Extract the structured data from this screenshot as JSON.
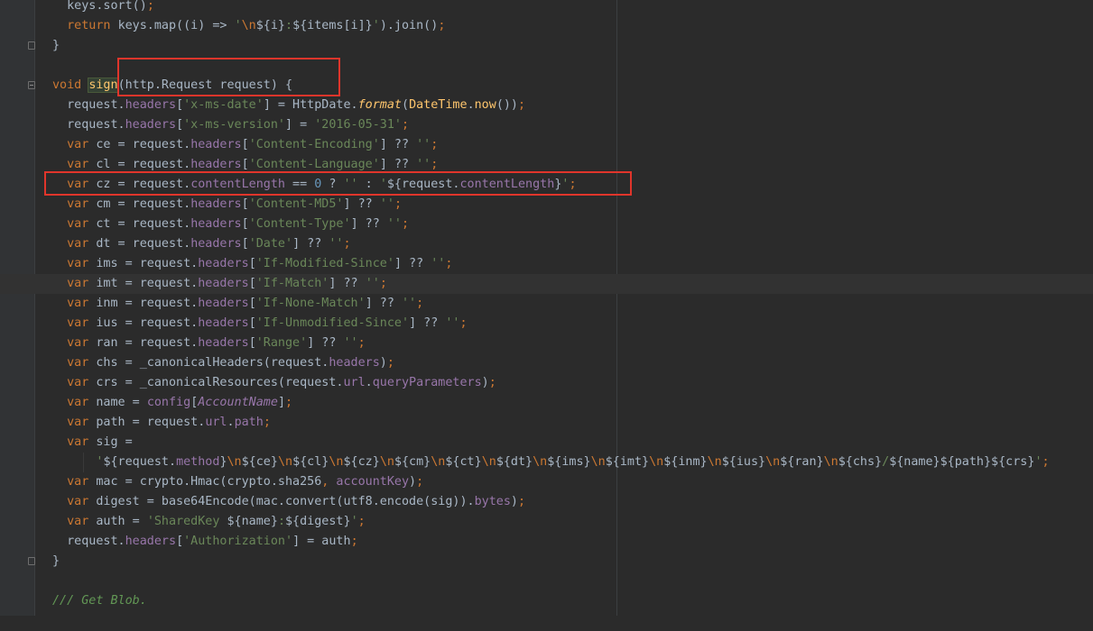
{
  "code_lines": [
    {
      "indent": "  ",
      "tokens": [
        [
          "t",
          "keys.sort()"
        ],
        [
          "k",
          ";"
        ]
      ]
    },
    {
      "indent": "  ",
      "tokens": [
        [
          "k",
          "return "
        ],
        [
          "t",
          "keys.map((i) => "
        ],
        [
          "s",
          "'"
        ],
        [
          "e",
          "\\n"
        ],
        [
          "t",
          "${i}"
        ],
        [
          "s",
          ":"
        ],
        [
          "t",
          "${items[i]}"
        ],
        [
          "s",
          "'"
        ],
        [
          "t",
          ").join()"
        ],
        [
          "k",
          ";"
        ]
      ]
    },
    {
      "indent": "",
      "tokens": [
        [
          "t",
          "}"
        ]
      ],
      "fold": "close"
    },
    {
      "indent": "",
      "tokens": []
    },
    {
      "indent": "",
      "tokens": [
        [
          "k",
          "void "
        ],
        [
          "sign",
          "sign"
        ],
        [
          "t",
          "(http.Request request) {"
        ]
      ],
      "fold": "open"
    },
    {
      "indent": "  ",
      "tokens": [
        [
          "t",
          "request."
        ],
        [
          "p",
          "headers"
        ],
        [
          "t",
          "["
        ],
        [
          "s",
          "'x-ms-date'"
        ],
        [
          "t",
          "] = HttpDate."
        ],
        [
          "fi",
          "format"
        ],
        [
          "t",
          "("
        ],
        [
          "f",
          "DateTime"
        ],
        [
          "t",
          "."
        ],
        [
          "f",
          "now"
        ],
        [
          "t",
          "())"
        ],
        [
          "k",
          ";"
        ]
      ]
    },
    {
      "indent": "  ",
      "tokens": [
        [
          "t",
          "request."
        ],
        [
          "p",
          "headers"
        ],
        [
          "t",
          "["
        ],
        [
          "s",
          "'x-ms-version'"
        ],
        [
          "t",
          "] = "
        ],
        [
          "s",
          "'2016-05-31'"
        ],
        [
          "k",
          ";"
        ]
      ]
    },
    {
      "indent": "  ",
      "tokens": [
        [
          "k",
          "var "
        ],
        [
          "t",
          "ce = request."
        ],
        [
          "p",
          "headers"
        ],
        [
          "t",
          "["
        ],
        [
          "s",
          "'Content-Encoding'"
        ],
        [
          "t",
          "] ?? "
        ],
        [
          "s",
          "''"
        ],
        [
          "k",
          ";"
        ]
      ]
    },
    {
      "indent": "  ",
      "tokens": [
        [
          "k",
          "var "
        ],
        [
          "t",
          "cl = request."
        ],
        [
          "p",
          "headers"
        ],
        [
          "t",
          "["
        ],
        [
          "s",
          "'Content-Language'"
        ],
        [
          "t",
          "] ?? "
        ],
        [
          "s",
          "''"
        ],
        [
          "k",
          ";"
        ]
      ]
    },
    {
      "indent": "  ",
      "tokens": [
        [
          "k",
          "var "
        ],
        [
          "t",
          "cz = request."
        ],
        [
          "p",
          "contentLength"
        ],
        [
          "t",
          " == "
        ],
        [
          "n",
          "0"
        ],
        [
          "t",
          " ? "
        ],
        [
          "s",
          "''"
        ],
        [
          "t",
          " : "
        ],
        [
          "s",
          "'"
        ],
        [
          "t",
          "${request."
        ],
        [
          "p",
          "contentLength"
        ],
        [
          "t",
          "}"
        ],
        [
          "s",
          "'"
        ],
        [
          "k",
          ";"
        ]
      ]
    },
    {
      "indent": "  ",
      "tokens": [
        [
          "k",
          "var "
        ],
        [
          "t",
          "cm = request."
        ],
        [
          "p",
          "headers"
        ],
        [
          "t",
          "["
        ],
        [
          "s",
          "'Content-MD5'"
        ],
        [
          "t",
          "] ?? "
        ],
        [
          "s",
          "''"
        ],
        [
          "k",
          ";"
        ]
      ]
    },
    {
      "indent": "  ",
      "tokens": [
        [
          "k",
          "var "
        ],
        [
          "t",
          "ct = request."
        ],
        [
          "p",
          "headers"
        ],
        [
          "t",
          "["
        ],
        [
          "s",
          "'Content-Type'"
        ],
        [
          "t",
          "] ?? "
        ],
        [
          "s",
          "''"
        ],
        [
          "k",
          ";"
        ]
      ]
    },
    {
      "indent": "  ",
      "tokens": [
        [
          "k",
          "var "
        ],
        [
          "t",
          "dt = request."
        ],
        [
          "p",
          "headers"
        ],
        [
          "t",
          "["
        ],
        [
          "s",
          "'Date'"
        ],
        [
          "t",
          "] ?? "
        ],
        [
          "s",
          "''"
        ],
        [
          "k",
          ";"
        ]
      ]
    },
    {
      "indent": "  ",
      "tokens": [
        [
          "k",
          "var "
        ],
        [
          "t",
          "ims = request."
        ],
        [
          "p",
          "headers"
        ],
        [
          "t",
          "["
        ],
        [
          "s",
          "'If-Modified-Since'"
        ],
        [
          "t",
          "] ?? "
        ],
        [
          "s",
          "''"
        ],
        [
          "k",
          ";"
        ]
      ]
    },
    {
      "indent": "  ",
      "tokens": [
        [
          "k",
          "var "
        ],
        [
          "t",
          "imt = request."
        ],
        [
          "p",
          "headers"
        ],
        [
          "t",
          "["
        ],
        [
          "s",
          "'If-Match'"
        ],
        [
          "t",
          "] ?? "
        ],
        [
          "s",
          "''"
        ],
        [
          "k",
          ";"
        ]
      ],
      "highlight": true
    },
    {
      "indent": "  ",
      "tokens": [
        [
          "k",
          "var "
        ],
        [
          "t",
          "inm = request."
        ],
        [
          "p",
          "headers"
        ],
        [
          "t",
          "["
        ],
        [
          "s",
          "'If-None-Match'"
        ],
        [
          "t",
          "] ?? "
        ],
        [
          "s",
          "''"
        ],
        [
          "k",
          ";"
        ]
      ]
    },
    {
      "indent": "  ",
      "tokens": [
        [
          "k",
          "var "
        ],
        [
          "t",
          "ius = request."
        ],
        [
          "p",
          "headers"
        ],
        [
          "t",
          "["
        ],
        [
          "s",
          "'If-Unmodified-Since'"
        ],
        [
          "t",
          "] ?? "
        ],
        [
          "s",
          "''"
        ],
        [
          "k",
          ";"
        ]
      ]
    },
    {
      "indent": "  ",
      "tokens": [
        [
          "k",
          "var "
        ],
        [
          "t",
          "ran = request."
        ],
        [
          "p",
          "headers"
        ],
        [
          "t",
          "["
        ],
        [
          "s",
          "'Range'"
        ],
        [
          "t",
          "] ?? "
        ],
        [
          "s",
          "''"
        ],
        [
          "k",
          ";"
        ]
      ]
    },
    {
      "indent": "  ",
      "tokens": [
        [
          "k",
          "var "
        ],
        [
          "t",
          "chs = _canonicalHeaders(request."
        ],
        [
          "p",
          "headers"
        ],
        [
          "t",
          ")"
        ],
        [
          "k",
          ";"
        ]
      ]
    },
    {
      "indent": "  ",
      "tokens": [
        [
          "k",
          "var "
        ],
        [
          "t",
          "crs = _canonicalResources(request."
        ],
        [
          "p",
          "url"
        ],
        [
          "t",
          "."
        ],
        [
          "p",
          "queryParameters"
        ],
        [
          "t",
          ")"
        ],
        [
          "k",
          ";"
        ]
      ]
    },
    {
      "indent": "  ",
      "tokens": [
        [
          "k",
          "var "
        ],
        [
          "t",
          "name = "
        ],
        [
          "p",
          "config"
        ],
        [
          "t",
          "["
        ],
        [
          "pi",
          "AccountName"
        ],
        [
          "t",
          "]"
        ],
        [
          "k",
          ";"
        ]
      ]
    },
    {
      "indent": "  ",
      "tokens": [
        [
          "k",
          "var "
        ],
        [
          "t",
          "path = request."
        ],
        [
          "p",
          "url"
        ],
        [
          "t",
          "."
        ],
        [
          "p",
          "path"
        ],
        [
          "k",
          ";"
        ]
      ]
    },
    {
      "indent": "  ",
      "tokens": [
        [
          "k",
          "var "
        ],
        [
          "t",
          "sig ="
        ]
      ]
    },
    {
      "indent": "      ",
      "tokens": [
        [
          "s",
          "'"
        ],
        [
          "t",
          "${request."
        ],
        [
          "p",
          "method"
        ],
        [
          "t",
          "}"
        ],
        [
          "e",
          "\\n"
        ],
        [
          "t",
          "${ce}"
        ],
        [
          "e",
          "\\n"
        ],
        [
          "t",
          "${cl}"
        ],
        [
          "e",
          "\\n"
        ],
        [
          "t",
          "${cz}"
        ],
        [
          "e",
          "\\n"
        ],
        [
          "t",
          "${cm}"
        ],
        [
          "e",
          "\\n"
        ],
        [
          "t",
          "${ct}"
        ],
        [
          "e",
          "\\n"
        ],
        [
          "t",
          "${dt}"
        ],
        [
          "e",
          "\\n"
        ],
        [
          "t",
          "${ims}"
        ],
        [
          "e",
          "\\n"
        ],
        [
          "t",
          "${imt}"
        ],
        [
          "e",
          "\\n"
        ],
        [
          "t",
          "${inm}"
        ],
        [
          "e",
          "\\n"
        ],
        [
          "t",
          "${ius}"
        ],
        [
          "e",
          "\\n"
        ],
        [
          "t",
          "${ran}"
        ],
        [
          "e",
          "\\n"
        ],
        [
          "t",
          "${chs}"
        ],
        [
          "s",
          "/"
        ],
        [
          "t",
          "${name}${path}${crs}"
        ],
        [
          "s",
          "'"
        ],
        [
          "k",
          ";"
        ]
      ],
      "guide": true
    },
    {
      "indent": "  ",
      "tokens": [
        [
          "k",
          "var "
        ],
        [
          "t",
          "mac = crypto.Hmac(crypto.sha256"
        ],
        [
          "k",
          ", "
        ],
        [
          "p",
          "accountKey"
        ],
        [
          "t",
          ")"
        ],
        [
          "k",
          ";"
        ]
      ]
    },
    {
      "indent": "  ",
      "tokens": [
        [
          "k",
          "var "
        ],
        [
          "t",
          "digest = base64Encode(mac.convert(utf8.encode(sig))."
        ],
        [
          "p",
          "bytes"
        ],
        [
          "t",
          ")"
        ],
        [
          "k",
          ";"
        ]
      ]
    },
    {
      "indent": "  ",
      "tokens": [
        [
          "k",
          "var "
        ],
        [
          "t",
          "auth = "
        ],
        [
          "s",
          "'SharedKey "
        ],
        [
          "t",
          "${name}"
        ],
        [
          "s",
          ":"
        ],
        [
          "t",
          "${digest}"
        ],
        [
          "s",
          "'"
        ],
        [
          "k",
          ";"
        ]
      ]
    },
    {
      "indent": "  ",
      "tokens": [
        [
          "t",
          "request."
        ],
        [
          "p",
          "headers"
        ],
        [
          "t",
          "["
        ],
        [
          "s",
          "'Authorization'"
        ],
        [
          "t",
          "] = auth"
        ],
        [
          "k",
          ";"
        ]
      ]
    },
    {
      "indent": "",
      "tokens": [
        [
          "t",
          "}"
        ]
      ],
      "fold": "close"
    },
    {
      "indent": "",
      "tokens": []
    },
    {
      "indent": "",
      "tokens": [
        [
          "c",
          "/// Get Blob."
        ]
      ]
    },
    {
      "indent": "",
      "tokens": []
    }
  ],
  "colors": {
    "background": "#2b2b2b",
    "annotation_box": "#e0352b"
  }
}
